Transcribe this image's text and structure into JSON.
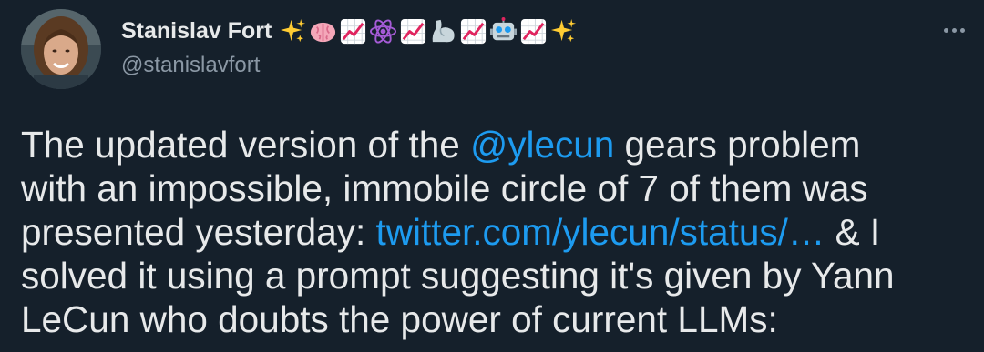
{
  "author": {
    "display_name": "Stanislav Fort",
    "handle": "@stanislavfort",
    "name_emojis": [
      "sparkles-icon",
      "brain-icon",
      "chart-increasing-icon",
      "atom-icon",
      "chart-increasing-icon",
      "flexed-biceps-icon",
      "chart-increasing-icon",
      "robot-icon",
      "chart-increasing-icon",
      "sparkles-icon"
    ]
  },
  "tweet": {
    "line1_a": "The updated version of the ",
    "mention": "@ylecun",
    "line1_b": " gears problem",
    "line2": "with an impossible, immobile circle of 7 of them was",
    "line3_a": "presented yesterday: ",
    "link_text": "twitter.com/ylecun/status/…",
    "line3_b": " & I",
    "line4": "solved it using a prompt suggesting it's given by Yann",
    "line5": "LeCun who doubts the power of current LLMs:"
  },
  "colors": {
    "background": "#15202b",
    "text": "#e7e9ea",
    "secondary": "#8b98a5",
    "link": "#1d9bf0"
  }
}
